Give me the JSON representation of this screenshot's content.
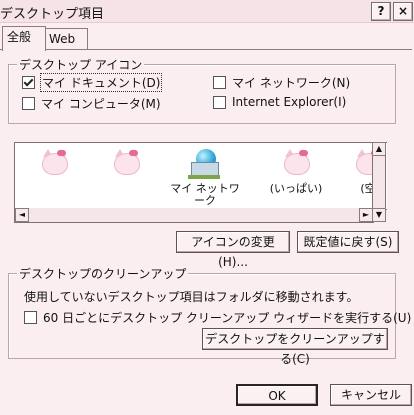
{
  "window": {
    "title": "デスクトップ項目",
    "help_label": "?",
    "close_label": "×"
  },
  "tabs": [
    {
      "label": "全般"
    },
    {
      "label": "Web"
    }
  ],
  "desktop_icons": {
    "group_label": "デスクトップ アイコン",
    "checkboxes": [
      {
        "label": "マイ ドキュメント(D)",
        "checked": true
      },
      {
        "label": "マイ ネットワーク(N)",
        "checked": false
      },
      {
        "label": "マイ コンピュータ(M)",
        "checked": false
      },
      {
        "label": "Internet Explorer(I)",
        "checked": false
      }
    ]
  },
  "icon_list": {
    "items": [
      {
        "label": "",
        "icon": "hello-kitty-icon"
      },
      {
        "label": "",
        "icon": "hello-kitty-icon"
      },
      {
        "label": "マイ ネットワーク",
        "icon": "network-icon"
      },
      {
        "label": "(いっぱい)",
        "icon": "hello-kitty-icon"
      },
      {
        "label": "(空",
        "icon": "hello-kitty-icon"
      }
    ],
    "scroll_left": "◄",
    "scroll_right": "►",
    "scroll_up": "▲",
    "scroll_down": "▼"
  },
  "buttons": {
    "change_icon": "アイコンの変更(H)...",
    "restore_default": "既定値に戻す(S)",
    "cleanup_now": "デスクトップをクリーンアップする(C)",
    "ok": "OK",
    "cancel": "キャンセル"
  },
  "cleanup": {
    "group_label": "デスクトップのクリーンアップ",
    "description": "使用していないデスクトップ項目はフォルダに移動されます。",
    "checkbox_label": "60 日ごとにデスクトップ クリーンアップ ウィザードを実行する(U)",
    "checkbox_checked": false
  }
}
